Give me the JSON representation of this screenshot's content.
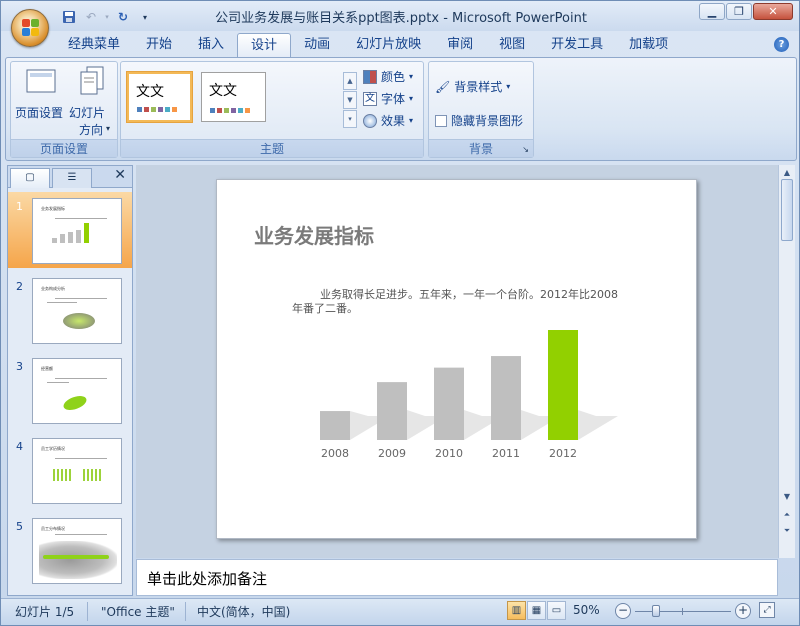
{
  "app": {
    "title": "公司业务发展与账目关系ppt图表.pptx - Microsoft PowerPoint",
    "window_controls": [
      "minimize-icon",
      "restore-icon",
      "close-icon"
    ]
  },
  "quick_access": [
    "save-icon",
    "undo-icon",
    "redo-icon",
    "customize-icon"
  ],
  "tabs": [
    {
      "label": "经典菜单",
      "active": false
    },
    {
      "label": "开始",
      "active": false
    },
    {
      "label": "插入",
      "active": false
    },
    {
      "label": "设计",
      "active": true
    },
    {
      "label": "动画",
      "active": false
    },
    {
      "label": "幻灯片放映",
      "active": false
    },
    {
      "label": "审阅",
      "active": false
    },
    {
      "label": "视图",
      "active": false
    },
    {
      "label": "开发工具",
      "active": false
    },
    {
      "label": "加载项",
      "active": false
    }
  ],
  "ribbon": {
    "page_setup": {
      "group_label": "页面设置",
      "page_setup_btn": "页面设置",
      "orientation_btn_line1": "幻灯片",
      "orientation_btn_line2": "方向"
    },
    "themes": {
      "group_label": "主题",
      "theme1": "文文",
      "theme2": "文文",
      "colors": "颜色",
      "fonts": "字体",
      "effects": "效果",
      "accent_colors": [
        "#4f81bd",
        "#c0504d",
        "#9bbb59",
        "#8064a2",
        "#4bacc6",
        "#f79646"
      ]
    },
    "background": {
      "group_label": "背景",
      "styles": "背景样式",
      "hide_graphics": "隐藏背景图形",
      "hide_graphics_checked": false
    }
  },
  "slide_pane": {
    "slides": [
      {
        "num": "1",
        "title": "业务发展指标",
        "selected": true
      },
      {
        "num": "2",
        "title": "业务构成分析",
        "selected": false
      },
      {
        "num": "3",
        "title": "经营额",
        "selected": false
      },
      {
        "num": "4",
        "title": "员工学历情况",
        "selected": false
      },
      {
        "num": "5",
        "title": "员工分布情况",
        "selected": false
      }
    ]
  },
  "slide": {
    "title": "业务发展指标",
    "body": "业务取得长足进步。五年来，一年一个台阶。2012年比2008年番了二番。"
  },
  "chart_data": {
    "type": "bar",
    "categories": [
      "2008",
      "2009",
      "2010",
      "2011",
      "2012"
    ],
    "values": [
      1,
      2,
      2.5,
      2.9,
      3.8
    ],
    "colors": [
      "#bfbfbf",
      "#bfbfbf",
      "#bfbfbf",
      "#bfbfbf",
      "#92d000"
    ],
    "title": "",
    "xlabel": "",
    "ylabel": ""
  },
  "notes": {
    "placeholder": "单击此处添加备注"
  },
  "status": {
    "slide_info": "幻灯片 1/5",
    "theme": "\"Office 主题\"",
    "language": "中文(简体，中国)",
    "zoom": "50%",
    "zoom_fraction": 0.5
  }
}
